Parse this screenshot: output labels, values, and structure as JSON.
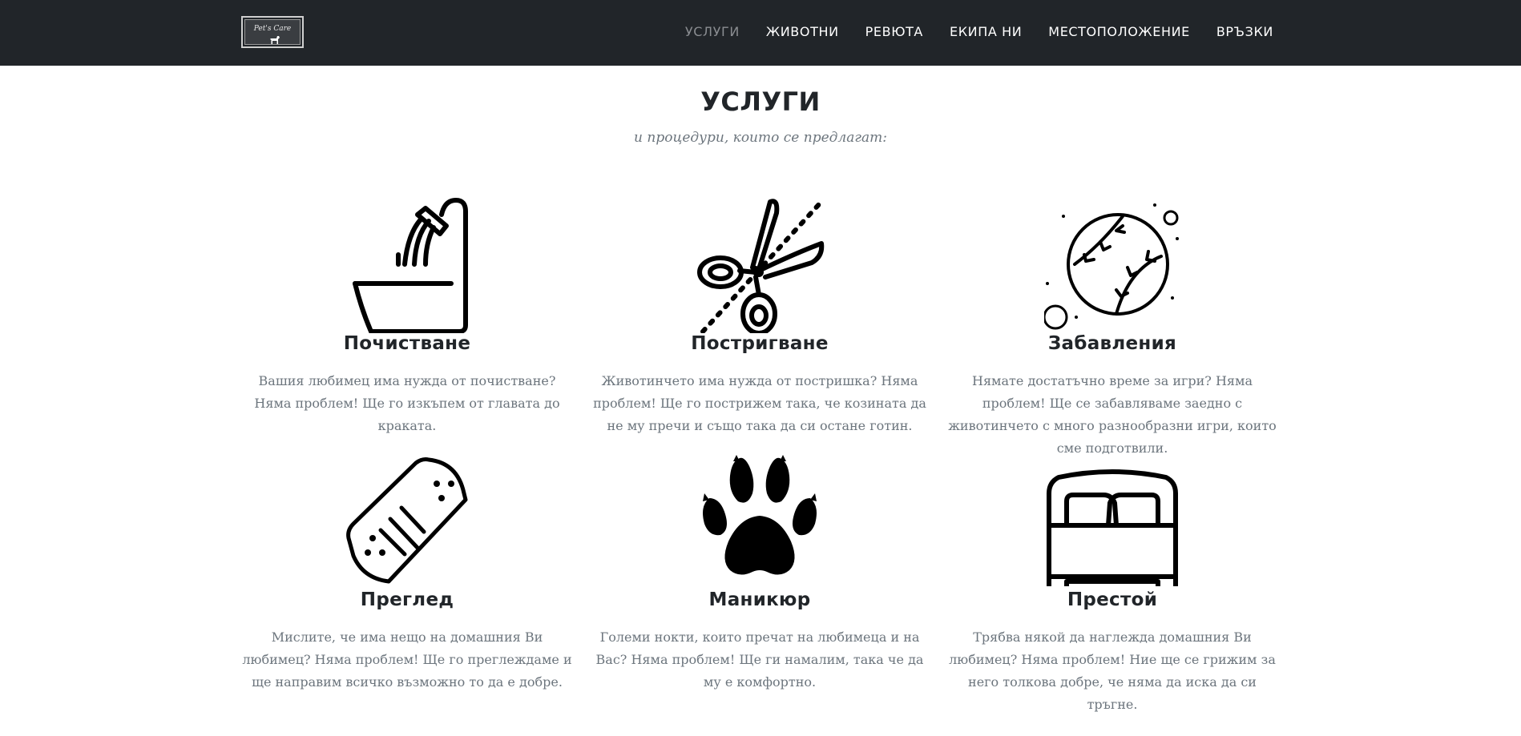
{
  "logo": {
    "text": "Pet's Care"
  },
  "nav": {
    "items": [
      {
        "label": "УСЛУГИ",
        "active": true
      },
      {
        "label": "ЖИВОТНИ",
        "active": false
      },
      {
        "label": "РЕВЮТА",
        "active": false
      },
      {
        "label": "ЕКИПА НИ",
        "active": false
      },
      {
        "label": "МЕСТОПОЛОЖЕНИЕ",
        "active": false
      },
      {
        "label": "ВРЪЗКИ",
        "active": false
      }
    ]
  },
  "services_section": {
    "title": "УСЛУГИ",
    "subtitle": "и процедури, които се предлагат:",
    "items": [
      {
        "icon": "bathtub-shower-icon",
        "title": "Почистване",
        "text": "Вашия любимец има нужда от почистване? Няма проблем! Ще го изкъпем от главата до краката."
      },
      {
        "icon": "scissors-icon",
        "title": "Постригване",
        "text": "Животинчето има нужда от постришка? Няма проблем! Ще го пострижем така, че козината да не му пречи и също така да си остане готин."
      },
      {
        "icon": "ball-icon",
        "title": "Забавления",
        "text": "Нямате достатъчно време за игри? Няма проблем! Ще се забавляваме заедно с животинчето с много разнообразни игри, които сме подготвили."
      },
      {
        "icon": "bandage-icon",
        "title": "Преглед",
        "text": "Мислите, че има нещо на домашния Ви любимец? Няма проблем! Ще го преглеждаме и ще направим всичко възможно то да е добре."
      },
      {
        "icon": "paw-icon",
        "title": "Маникюр",
        "text": "Големи нокти, които пречат на любимеца и на Вас? Няма проблем! Ще ги намалим, така че да му е комфортно."
      },
      {
        "icon": "bed-icon",
        "title": "Престой",
        "text": "Трябва някой да наглежда домашния Ви любимец? Няма проблем! Ние ще се грижим за него толкова добре, че няма да иска да си тръгне."
      }
    ]
  },
  "colors": {
    "navbar": "#212529",
    "nav_active": "#8a8d91",
    "text_muted": "#6c757d"
  }
}
